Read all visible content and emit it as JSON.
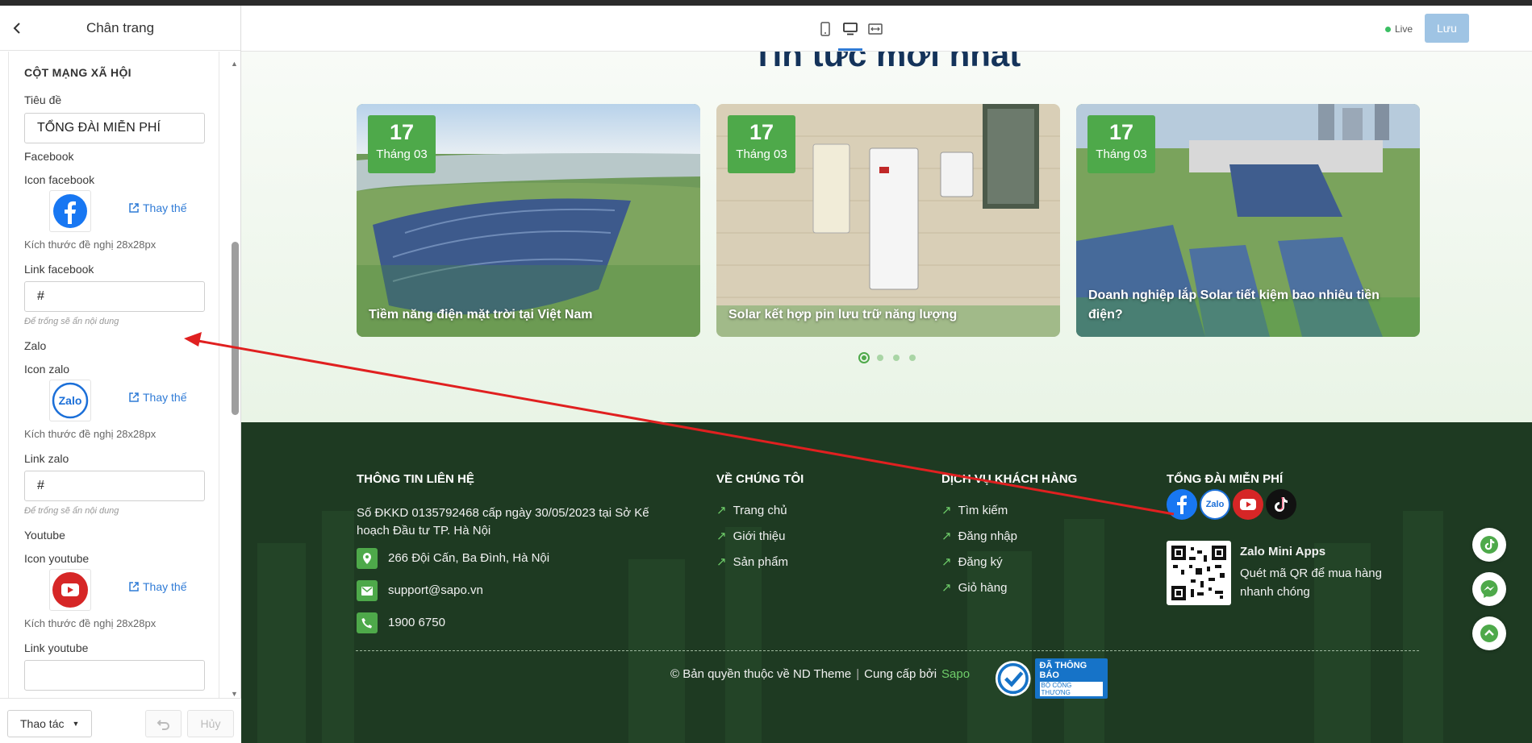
{
  "panel": {
    "title": "Chân trang",
    "section_title": "CỘT MẠNG XÃ HỘI",
    "title_label": "Tiêu đề",
    "title_value": "TỔNG ĐÀI MIỄN PHÍ",
    "facebook_group": "Facebook",
    "icon_facebook_label": "Icon facebook",
    "replace_label": "Thay thế",
    "size_hint": "Kích thước đề nghị 28x28px",
    "link_facebook_label": "Link facebook",
    "link_facebook_value": "#",
    "empty_hint": "Để trống sẽ ẩn nội dung",
    "zalo_group": "Zalo",
    "icon_zalo_label": "Icon zalo",
    "link_zalo_label": "Link zalo",
    "link_zalo_value": "#",
    "youtube_group": "Youtube",
    "icon_youtube_label": "Icon youtube",
    "link_youtube_label": "Link youtube",
    "actions_label": "Thao tác",
    "cancel_label": "Hủy"
  },
  "toolbar": {
    "live_label": "Live",
    "save_label": "Lưu"
  },
  "news": {
    "title": "Tin tức mới nhất",
    "cards": [
      {
        "day": "17",
        "month": "Tháng 03",
        "title": "Tiềm năng điện mặt trời tại Việt Nam"
      },
      {
        "day": "17",
        "month": "Tháng 03",
        "title": "Solar kết hợp pin lưu trữ năng lượng"
      },
      {
        "day": "17",
        "month": "Tháng 03",
        "title": "Doanh nghiệp lắp Solar tiết kiệm bao nhiêu tiền điện?"
      }
    ]
  },
  "footer": {
    "contact_heading": "THÔNG TIN LIÊN HỆ",
    "registration": "Số ĐKKD 0135792468 cấp ngày 30/05/2023 tại Sở Kế hoạch Đầu tư TP. Hà Nội",
    "address": "266 Đội Cấn, Ba Đình, Hà Nội",
    "email": "support@sapo.vn",
    "phone": "1900 6750",
    "about_heading": "VỀ CHÚNG TÔI",
    "about_links": [
      "Trang chủ",
      "Giới thiệu",
      "Sản phẩm"
    ],
    "service_heading": "DỊCH VỤ KHÁCH HÀNG",
    "service_links": [
      "Tìm kiếm",
      "Đăng nhập",
      "Đăng ký",
      "Giỏ hàng"
    ],
    "hotline_heading": "TỔNG ĐÀI MIỄN PHÍ",
    "zalo_title": "Zalo Mini Apps",
    "zalo_desc": "Quét mã QR để mua hàng nhanh chóng",
    "copyright": "© Bản quyền thuộc về ND Theme",
    "provided_by": "Cung cấp bởi",
    "provider": "Sapo",
    "bct_line1": "ĐÃ THÔNG BÁO",
    "bct_line2": "BỘ CÔNG THƯƠNG"
  },
  "colors": {
    "accent_green": "#4ea94a",
    "footer_bg": "#1e3a22",
    "link_blue": "#2f7bd6",
    "save_button": "#9fc4e4",
    "annotation_arrow": "#e02020"
  }
}
